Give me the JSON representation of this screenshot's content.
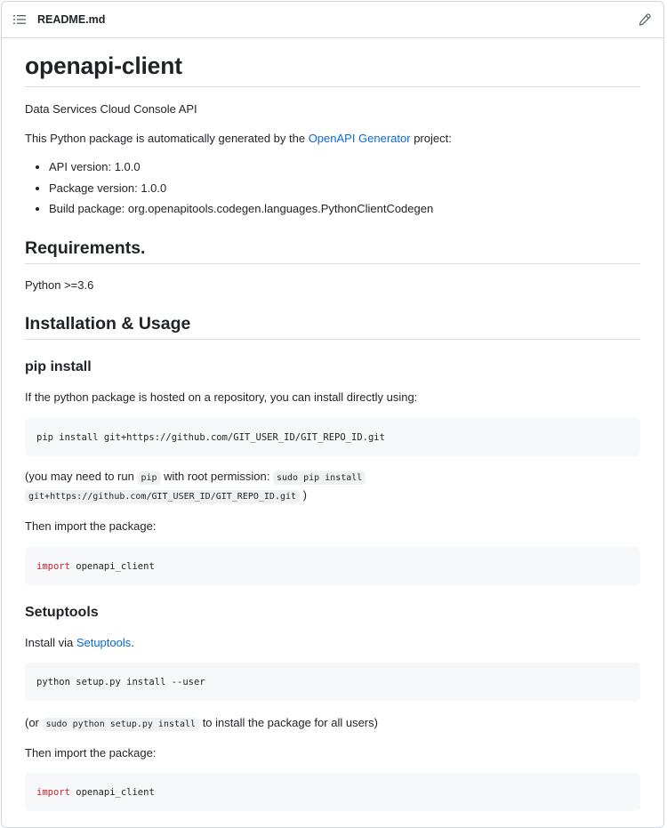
{
  "header": {
    "filename": "README.md",
    "icons": [
      "list-icon",
      "pencil-icon"
    ]
  },
  "content": {
    "title": "openapi-client",
    "description": "Data Services Cloud Console API",
    "intro": {
      "prefix": "This Python package is automatically generated by the ",
      "link": "OpenAPI Generator",
      "suffix": " project:"
    },
    "bullets": [
      "API version: 1.0.0",
      "Package version: 1.0.0",
      "Build package: org.openapitools.codegen.languages.PythonClientCodegen"
    ],
    "requirements": {
      "heading": "Requirements.",
      "text": "Python >=3.6"
    },
    "installation": {
      "heading": "Installation & Usage",
      "pip": {
        "heading": "pip install",
        "text": "If the python package is hosted on a repository, you can install directly using:",
        "code": "pip install git+https://github.com/GIT_USER_ID/GIT_REPO_ID.git",
        "note_prefix": "(you may need to run ",
        "note_code1": "pip",
        "note_middle": " with root permission: ",
        "note_code2a": "sudo pip install",
        "note_code2b": "git+https://github.com/GIT_USER_ID/GIT_REPO_ID.git",
        "note_suffix": " )",
        "import_text": "Then import the package:",
        "import_keyword": "import",
        "import_module": " openapi_client"
      },
      "setuptools": {
        "heading": "Setuptools",
        "text_prefix": "Install via ",
        "link": "Setuptools",
        "text_suffix": ".",
        "code": "python setup.py install --user",
        "note_prefix": "(or ",
        "note_code": "sudo python setup.py install",
        "note_suffix": " to install the package for all users)",
        "import_text": "Then import the package:",
        "import_keyword": "import",
        "import_module": " openapi_client"
      }
    }
  }
}
